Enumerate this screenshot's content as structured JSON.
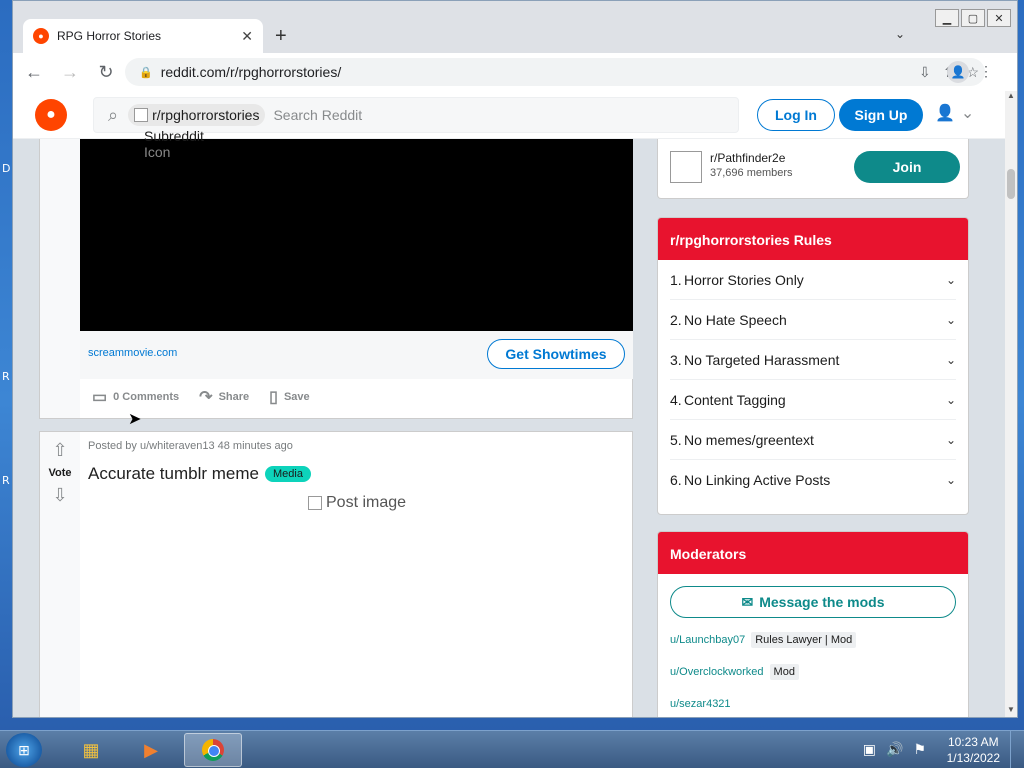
{
  "desktop": {
    "letters": [
      "D",
      "R",
      "R"
    ]
  },
  "browser": {
    "tab_title": "RPG Horror Stories",
    "tab_close": "✕",
    "new_tab": "+",
    "url": "reddit.com/r/rpghorrorstories/"
  },
  "reddit": {
    "logo": "●",
    "subreddit_chip": "r/rpghorrorstories",
    "subreddit_icon_alt_1": "Subreddit",
    "subreddit_icon_alt_2": "Icon",
    "search_placeholder": "Search Reddit",
    "login": "Log In",
    "signup": "Sign Up"
  },
  "post1": {
    "link_domain": "screammovie.com",
    "cta": "Get Showtimes",
    "comments": "0 Comments",
    "share": "Share",
    "save": "Save"
  },
  "post2": {
    "vote_label": "Vote",
    "posted_by": "Posted by u/whiteraven13 48 minutes ago",
    "title": "Accurate tumblr meme",
    "flair": "Media",
    "image_alt": "Post image"
  },
  "related": {
    "name": "r/Pathfinder2e",
    "members": "37,696 members",
    "join": "Join"
  },
  "rules": {
    "header": "r/rpghorrorstories Rules",
    "items": [
      {
        "num": "1.",
        "text": "Horror Stories Only"
      },
      {
        "num": "2.",
        "text": "No Hate Speech"
      },
      {
        "num": "3.",
        "text": "No Targeted Harassment"
      },
      {
        "num": "4.",
        "text": "Content Tagging"
      },
      {
        "num": "5.",
        "text": "No memes/greentext"
      },
      {
        "num": "6.",
        "text": "No Linking Active Posts"
      }
    ]
  },
  "moderators": {
    "header": "Moderators",
    "message_button": "Message the mods",
    "mods": [
      {
        "name": "u/Launchbay07",
        "flair": "Rules Lawyer | Mod"
      },
      {
        "name": "u/Overclockworked",
        "flair": "Mod"
      },
      {
        "name": "u/sezar4321",
        "flair": ""
      }
    ]
  },
  "taskbar": {
    "time": "10:23 AM",
    "date": "1/13/2022"
  }
}
